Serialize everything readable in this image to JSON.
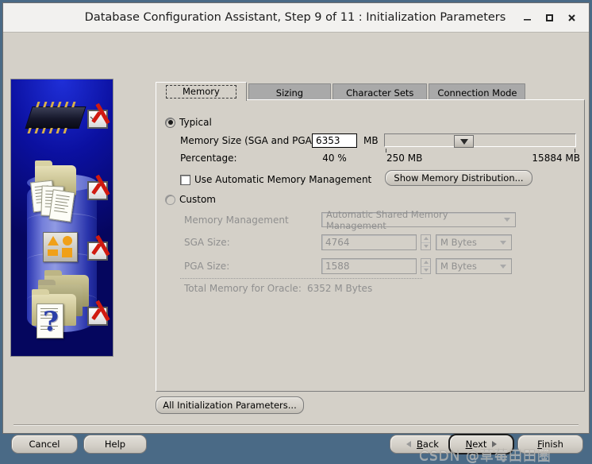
{
  "window": {
    "title": "Database Configuration Assistant, Step 9 of 11 : Initialization Parameters",
    "minimize_label": "_",
    "maximize_label": "□",
    "close_label": "✕"
  },
  "tabs": [
    {
      "label": "Memory",
      "selected": true
    },
    {
      "label": "Sizing",
      "selected": false
    },
    {
      "label": "Character Sets",
      "selected": false
    },
    {
      "label": "Connection Mode",
      "selected": false
    }
  ],
  "memory_tab": {
    "typical": {
      "radio_label": "Typical",
      "selected": true,
      "memory_size_label": "Memory Size (SGA and PGA):",
      "memory_size_value": "6353",
      "memory_size_unit": "MB",
      "percentage_label": "Percentage:",
      "percentage_value": "40 %",
      "slider_min_label": "250 MB",
      "slider_max_label": "15884 MB",
      "slider_percent": 40,
      "amm_checkbox_label": "Use Automatic Memory Management",
      "amm_checked": false,
      "show_distribution_button": "Show Memory Distribution..."
    },
    "custom": {
      "radio_label": "Custom",
      "selected": false,
      "memory_management_label": "Memory Management",
      "memory_management_value": "Automatic Shared Memory Management",
      "sga_label": "SGA Size:",
      "sga_value": "4764",
      "sga_unit": "M Bytes",
      "pga_label": "PGA Size:",
      "pga_value": "1588",
      "pga_unit": "M Bytes",
      "total_label": "Total Memory for Oracle:",
      "total_value": "6352 M Bytes"
    }
  },
  "all_params_button": "All Initialization Parameters...",
  "footer": {
    "cancel": "Cancel",
    "help": "Help",
    "back": "Back",
    "next": "Next",
    "finish": "Finish"
  },
  "watermark": "CSDN @草莓田田圈",
  "colors": {
    "window_bg": "#d4d0c8",
    "titlebar_bg": "#f2f1ef",
    "tab_unselected": "#a9a9a9",
    "illustration_blue": "#0b10a0",
    "check_red": "#d01a10",
    "desktop": "#4a6a86"
  }
}
